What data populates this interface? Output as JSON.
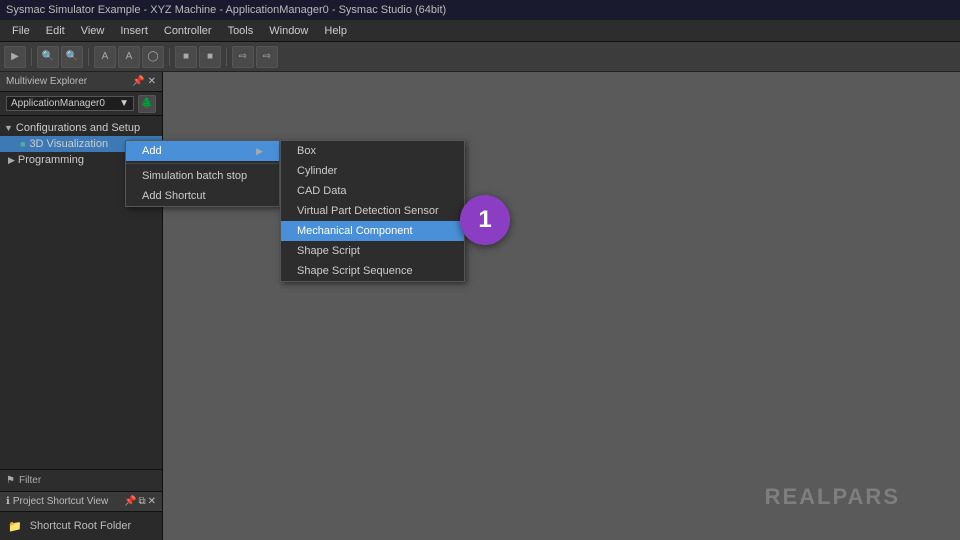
{
  "titlebar": {
    "text": "Sysmac Simulator Example - XYZ Machine - ApplicationManager0 - Sysmac Studio (64bit)"
  },
  "menubar": {
    "items": [
      "File",
      "Edit",
      "View",
      "Insert",
      "Controller",
      "Tools",
      "Window",
      "Help"
    ]
  },
  "sidebar": {
    "title": "Multiview Explorer",
    "app_manager": "ApplicationManager0",
    "tree": {
      "configurations_label": "Configurations and Setup",
      "visualization_label": "3D Visualization",
      "programming_label": "Programming"
    },
    "filter_label": "Filter",
    "shortcut_view_label": "Project Shortcut View",
    "shortcut_root_label": "Shortcut Root Folder"
  },
  "context_menu_add": {
    "title": "Add",
    "items": [
      {
        "label": "Simulation batch stop",
        "has_sub": false
      },
      {
        "label": "Add Shortcut",
        "has_sub": false
      }
    ]
  },
  "submenu": {
    "items": [
      {
        "label": "Box"
      },
      {
        "label": "Cylinder"
      },
      {
        "label": "CAD Data"
      },
      {
        "label": "Virtual Part Detection Sensor"
      },
      {
        "label": "Mechanical Component",
        "highlighted": true
      },
      {
        "label": "Shape Script"
      },
      {
        "label": "Shape Script Sequence"
      }
    ]
  },
  "step_badge": "1",
  "watermark": "REALPARS"
}
